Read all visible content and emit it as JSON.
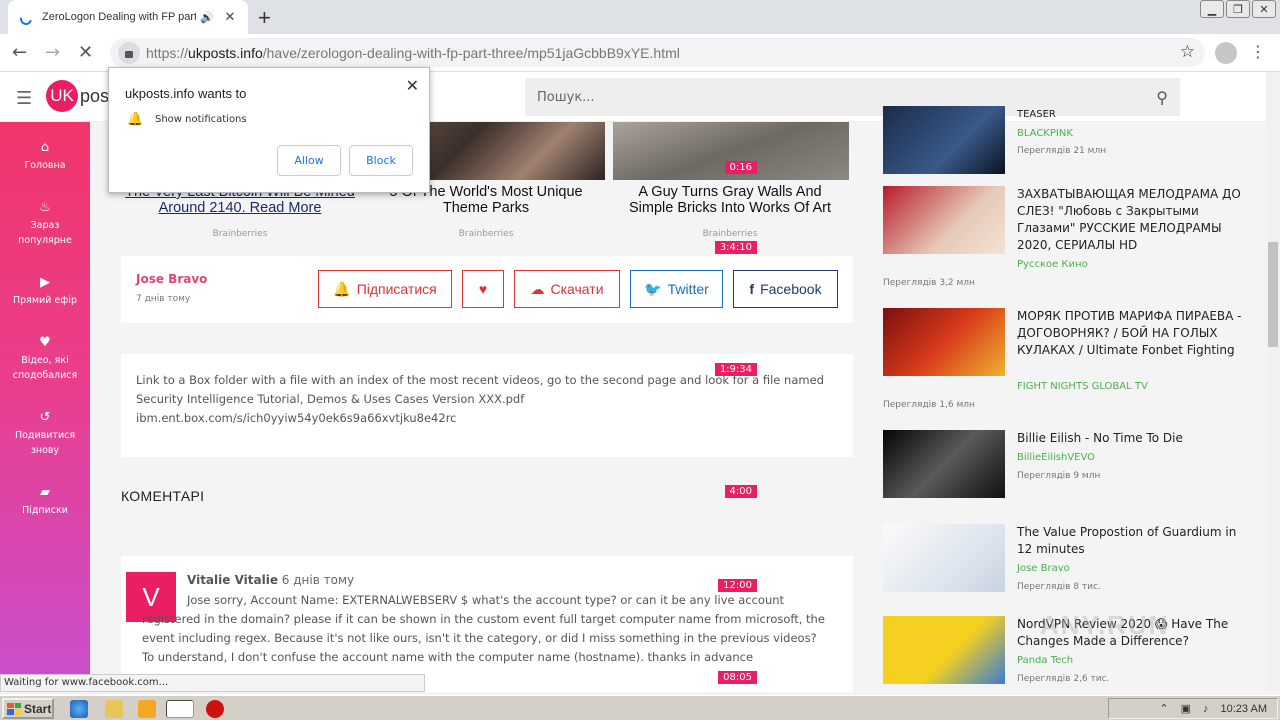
{
  "browser": {
    "tab_title": "ZeroLogon Dealing with FP part",
    "url_prefix": "https://",
    "url_host": "ukposts.info",
    "url_path": "/have/zerologon-dealing-with-fp-part-three/mp51jaGcbbB9xYE.html",
    "status": "Waiting for www.facebook.com..."
  },
  "header": {
    "logo": "UK",
    "logo_text": "pos",
    "search_placeholder": "Пошук..."
  },
  "sidebar": {
    "items": [
      {
        "label": "Головна",
        "icon": "home-icon"
      },
      {
        "label": "Зараз популярне",
        "icon": "fire-icon"
      },
      {
        "label": "Прямий ефір",
        "icon": "live-icon"
      },
      {
        "label": "Відео, які сподобалися",
        "icon": "heart-icon"
      },
      {
        "label": "Подивитися знову",
        "icon": "history-icon"
      },
      {
        "label": "Підписки",
        "icon": "folder-icon"
      }
    ]
  },
  "promos": [
    {
      "title": "The Very Last Bitcoin Will Be Mined Around 2140. Read More",
      "source": "Brainberries"
    },
    {
      "title": "5 Of The World's Most Unique Theme Parks",
      "source": "Brainberries"
    },
    {
      "title": "A Guy Turns Gray Walls And Simple Bricks Into Works Of Art",
      "source": "Brainberries"
    }
  ],
  "video": {
    "author": "Jose Bravo",
    "posted": "7 днів тому",
    "subscribe": "Підписатися",
    "download": "Скачати",
    "twitter": "Twitter",
    "facebook": "Facebook",
    "description": "Link to a Box folder with a file with an index of the most recent videos, go to the second page and look for a file named Security Intelligence Tutorial, Demos & Uses Cases Version XXX.pdf ibm.ent.box.com/s/ich0yyiw54y0ek6s9a66xvtjku8e42rc"
  },
  "comments": {
    "heading": "КОМЕНТАРІ",
    "items": [
      {
        "avatar": "V",
        "author": "Vitalie Vitalie",
        "time": "6 днів тому",
        "text": "Jose sorry, Account Name: EXTERNALWEBSERV $ what's the account type? or can it be any live account registered in the domain? please if it can be shown in the custom event full target computer name from microsoft, the event including regex. Because it's not like ours, isn't it the category, or did I miss something in the previous videos? To understand, I don't confuse the account name with the computer name (hostname). thanks in advance"
      }
    ]
  },
  "related": [
    {
      "title": "TEASER",
      "channel": "BLACKPINK",
      "views": "Переглядів 21 млн",
      "duration": "0:16"
    },
    {
      "title": "ЗАХВАТЫВАЮЩАЯ МЕЛОДРАМА ДО СЛЕЗ! \"Любовь с Закрытыми Глазами\" РУССКИЕ МЕЛОДРАМЫ 2020, СЕРИАЛЫ HD",
      "channel": "Русское Кино",
      "views": "Переглядів 3,2 млн",
      "duration": "3:4:10"
    },
    {
      "title": "МОРЯК ПРОТИВ МАРИФА ПИРАЕВА - ДОГОВОРНЯК? / БОЙ НА ГОЛЫХ КУЛАКАХ / Ultimate Fonbet Fighting",
      "channel": "FIGHT NIGHTS GLOBAL TV",
      "views": "Переглядів 1,6 млн",
      "duration": "1:9:34"
    },
    {
      "title": "Billie Eilish - No Time To Die",
      "channel": "BillieEilishVEVO",
      "views": "Переглядів 9 млн",
      "duration": "4:00"
    },
    {
      "title": "The Value Propostion of Guardium in 12 minutes",
      "channel": "Jose Bravo",
      "views": "Переглядів 8 тис.",
      "duration": "12:00"
    },
    {
      "title": "NordVPN Review 2020 😱 Have The Changes Made a Difference?",
      "channel": "Panda Tech",
      "views": "Переглядів 2,6 тис.",
      "duration": "08:05"
    }
  ],
  "notification": {
    "title": "ukposts.info wants to",
    "text": "Show notifications",
    "allow": "Allow",
    "block": "Block"
  },
  "taskbar": {
    "start": "Start",
    "time": "10:23 AM"
  },
  "watermark": "ANY.RUN"
}
